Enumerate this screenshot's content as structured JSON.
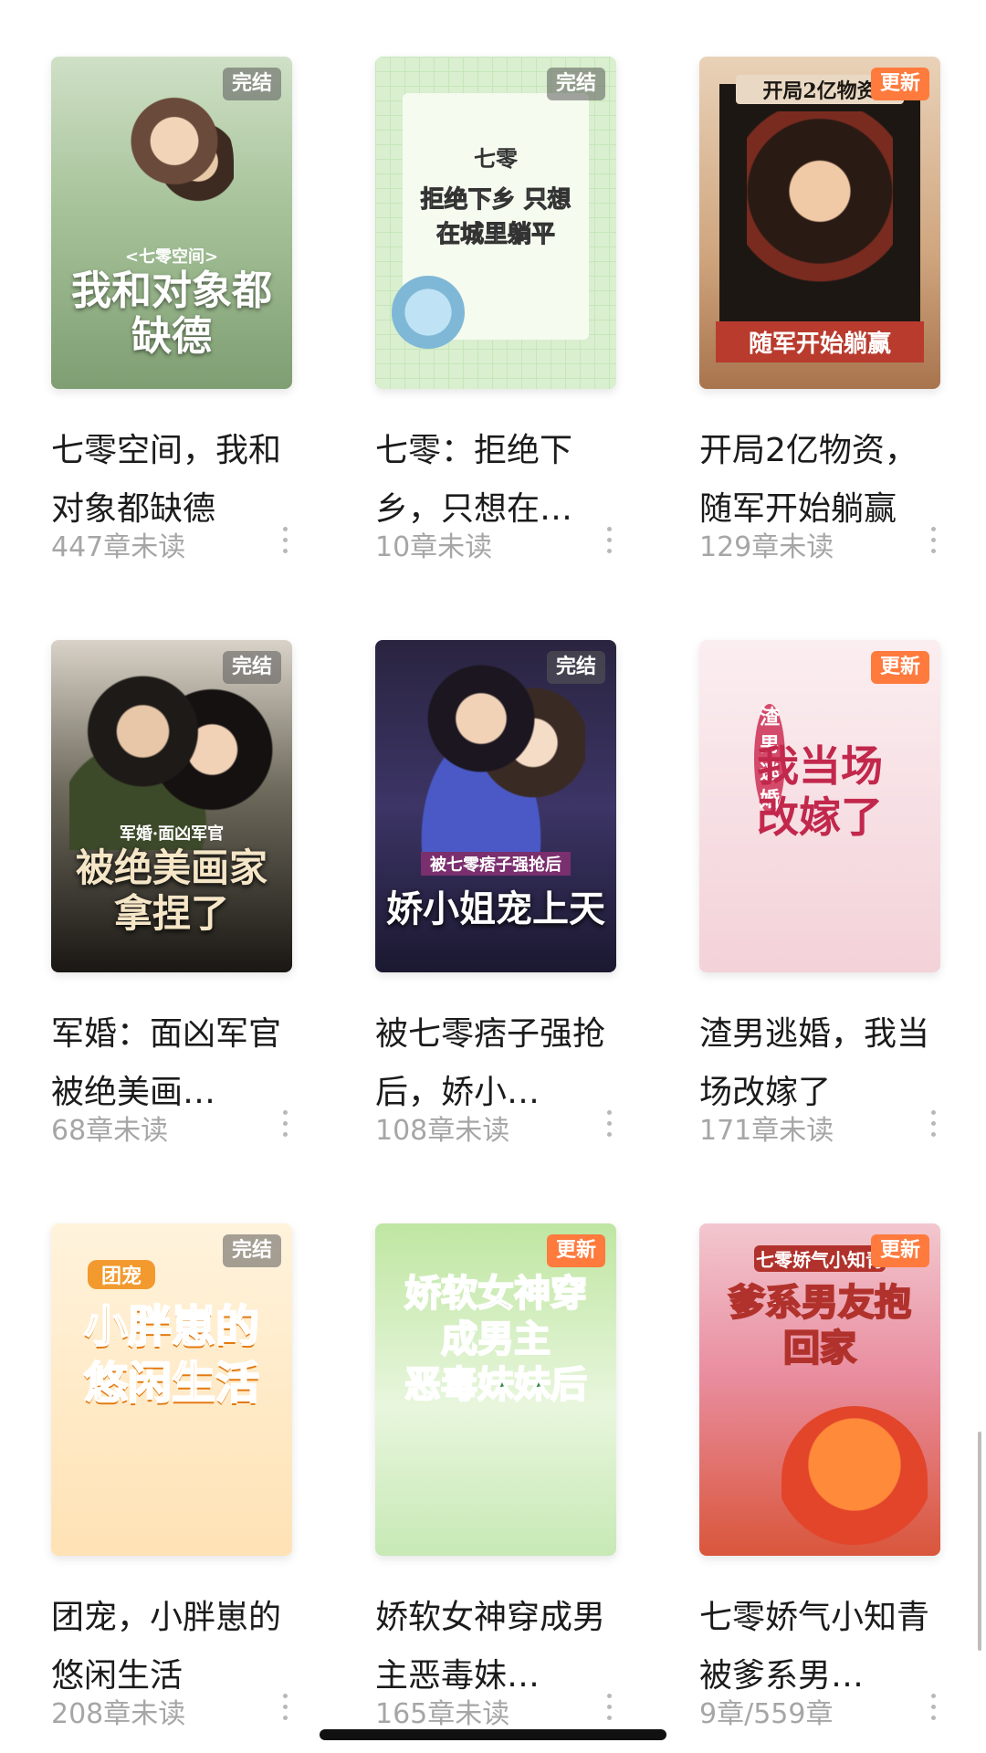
{
  "books": [
    {
      "title": "七零空间，我和对象都缺德",
      "progress": "447章未读",
      "status": "完结",
      "cover_text_a": "<七零空间>",
      "cover_text_b": "我和对象都缺德"
    },
    {
      "title": "七零：拒绝下乡，只想在…",
      "progress": "10章未读",
      "status": "完结",
      "cover_text_a": "七零",
      "cover_text_b": "拒绝下乡 只想在城里躺平"
    },
    {
      "title": "开局2亿物资，随军开始躺赢",
      "progress": "129章未读",
      "status": "更新",
      "cover_text_a": "开局2亿物资",
      "cover_text_b": "随军开始躺赢"
    },
    {
      "title": "军婚：面凶军官被绝美画…",
      "progress": "68章未读",
      "status": "完结",
      "cover_text_a": "军婚·面凶军官",
      "cover_text_b": "被绝美画家拿捏了"
    },
    {
      "title": "被七零痞子强抢后，娇小…",
      "progress": "108章未读",
      "status": "完结",
      "cover_text_a": "被七零痞子强抢后",
      "cover_text_b": "娇小姐宠上天"
    },
    {
      "title": "渣男逃婚，我当场改嫁了",
      "progress": "171章未读",
      "status": "更新",
      "cover_text_a": "渣男逃婚",
      "cover_text_b": "我当场改嫁了"
    },
    {
      "title": "团宠，小胖崽的悠闲生活",
      "progress": "208章未读",
      "status": "完结",
      "cover_text_a": "团宠",
      "cover_text_b": "小胖崽的悠闲生活"
    },
    {
      "title": "娇软女神穿成男主恶毒妹…",
      "progress": "165章未读",
      "status": "更新",
      "cover_text_a": "娇软女神穿成男主",
      "cover_text_b": "恶毒妹妹后"
    },
    {
      "title": "七零娇气小知青被爹系男…",
      "progress": "9章/559章",
      "status": "更新",
      "cover_text_a": "七零娇气小知青",
      "cover_text_b": "爹系男友抱回家"
    }
  ],
  "colors": {
    "badge_done": "#5a5a5a",
    "badge_update": "#ff7a3d",
    "progress_text": "#a6a6a6",
    "title_text": "#1b1b1b"
  }
}
